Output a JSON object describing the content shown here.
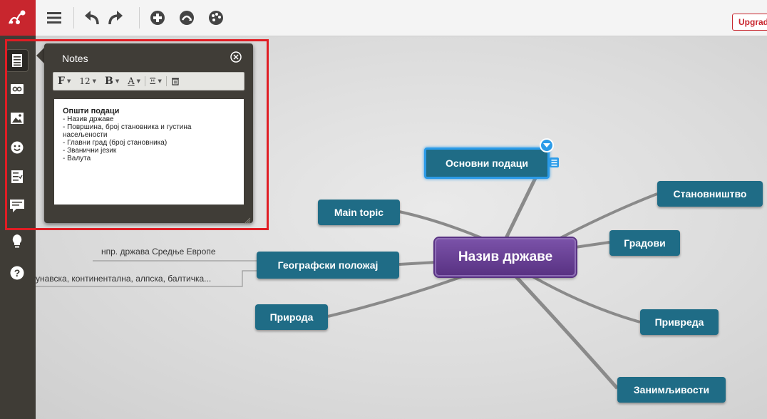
{
  "toolbar": {
    "upgrade_label": "Upgrad"
  },
  "sidebar": {
    "items": [
      {
        "icon": "notes-icon",
        "active": true
      },
      {
        "icon": "link-icon"
      },
      {
        "icon": "image-icon"
      },
      {
        "icon": "smiley-icon"
      },
      {
        "icon": "task-icon"
      },
      {
        "icon": "comment-icon"
      },
      {
        "icon": "lightbulb-icon"
      },
      {
        "icon": "help-icon"
      }
    ]
  },
  "notes_panel": {
    "title": "Notes",
    "font_label": "F",
    "size_label": "12",
    "bold_label": "B",
    "color_label": "A",
    "list_label": "Ξ",
    "body": {
      "heading": "Општи подаци",
      "lines": [
        "- Назив државе",
        "- Површина, број становника и густина",
        "насељености",
        "- Главни град (број становника)",
        "- Званични језик",
        "- Валута"
      ]
    }
  },
  "mindmap": {
    "central": "Назив државе",
    "nodes": {
      "osnovni": "Основни подаци",
      "stanovnistvo": "Становништво",
      "main_topic": "Main topic",
      "gradovi": "Градови",
      "geografski": "Географски положај",
      "priroda": "Природа",
      "privreda": "Привреда",
      "zanimljivosti": "Занимљивости"
    },
    "leaves": {
      "leaf1": "нпр. држава Средње Европе",
      "leaf2": "унавска, континентална, алпска, балтичка..."
    }
  },
  "colors": {
    "brand_red": "#c8262e",
    "node_teal": "#1f6c86",
    "central_purple": "#593283",
    "selection_blue": "#2b9be8",
    "sidebar_dark": "#3f3c36",
    "highlight_red": "#e01d24"
  }
}
